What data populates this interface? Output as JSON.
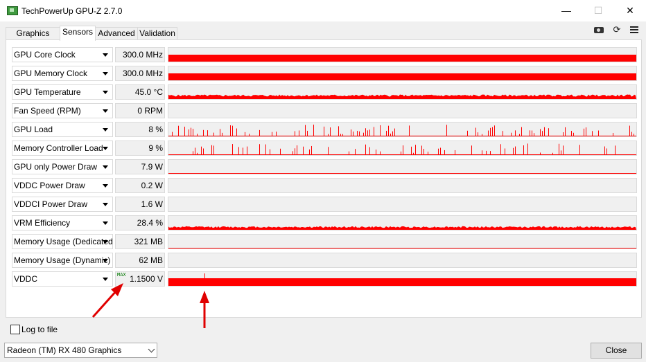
{
  "window": {
    "title": "TechPowerUp GPU-Z 2.7.0"
  },
  "tabs": [
    {
      "label": "Graphics Card"
    },
    {
      "label": "Sensors"
    },
    {
      "label": "Advanced"
    },
    {
      "label": "Validation"
    }
  ],
  "active_tab": "Sensors",
  "sensors": [
    {
      "name": "GPU Core Clock",
      "value": "300.0 MHz",
      "graph_level": 0.5
    },
    {
      "name": "GPU Memory Clock",
      "value": "300.0 MHz",
      "graph_level": 0.5
    },
    {
      "name": "GPU Temperature",
      "value": "45.0 °C",
      "graph_level": 0.25
    },
    {
      "name": "Fan Speed (RPM)",
      "value": "0 RPM",
      "graph_level": 0
    },
    {
      "name": "GPU Load",
      "value": "8 %",
      "graph_level": 0.08
    },
    {
      "name": "Memory Controller Load",
      "value": "9 %",
      "graph_level": 0.09
    },
    {
      "name": "GPU only Power Draw",
      "value": "7.9 W",
      "graph_level": 0.05
    },
    {
      "name": "VDDC Power Draw",
      "value": "0.2 W",
      "graph_level": 0
    },
    {
      "name": "VDDCI Power Draw",
      "value": "1.6 W",
      "graph_level": 0
    },
    {
      "name": "VRM Efficiency",
      "value": "28.4 %",
      "graph_level": 0.2
    },
    {
      "name": "Memory Usage (Dedicated)",
      "value": "321 MB",
      "graph_level": 0.05
    },
    {
      "name": "Memory Usage (Dynamic)",
      "value": "62 MB",
      "graph_level": 0
    },
    {
      "name": "VDDC",
      "value": "1.1500 V",
      "badge": "MAX",
      "graph_level": 0.55
    }
  ],
  "log_to_file": {
    "label": "Log to file",
    "checked": false
  },
  "gpu_select": {
    "value": "Radeon (TM) RX 480 Graphics"
  },
  "buttons": {
    "close": "Close"
  },
  "colors": {
    "graph": "#ff0000",
    "annotation_arrow": "#e00000",
    "max_badge": "#007800"
  },
  "icons": [
    "camera-icon",
    "refresh-icon",
    "menu-icon"
  ]
}
